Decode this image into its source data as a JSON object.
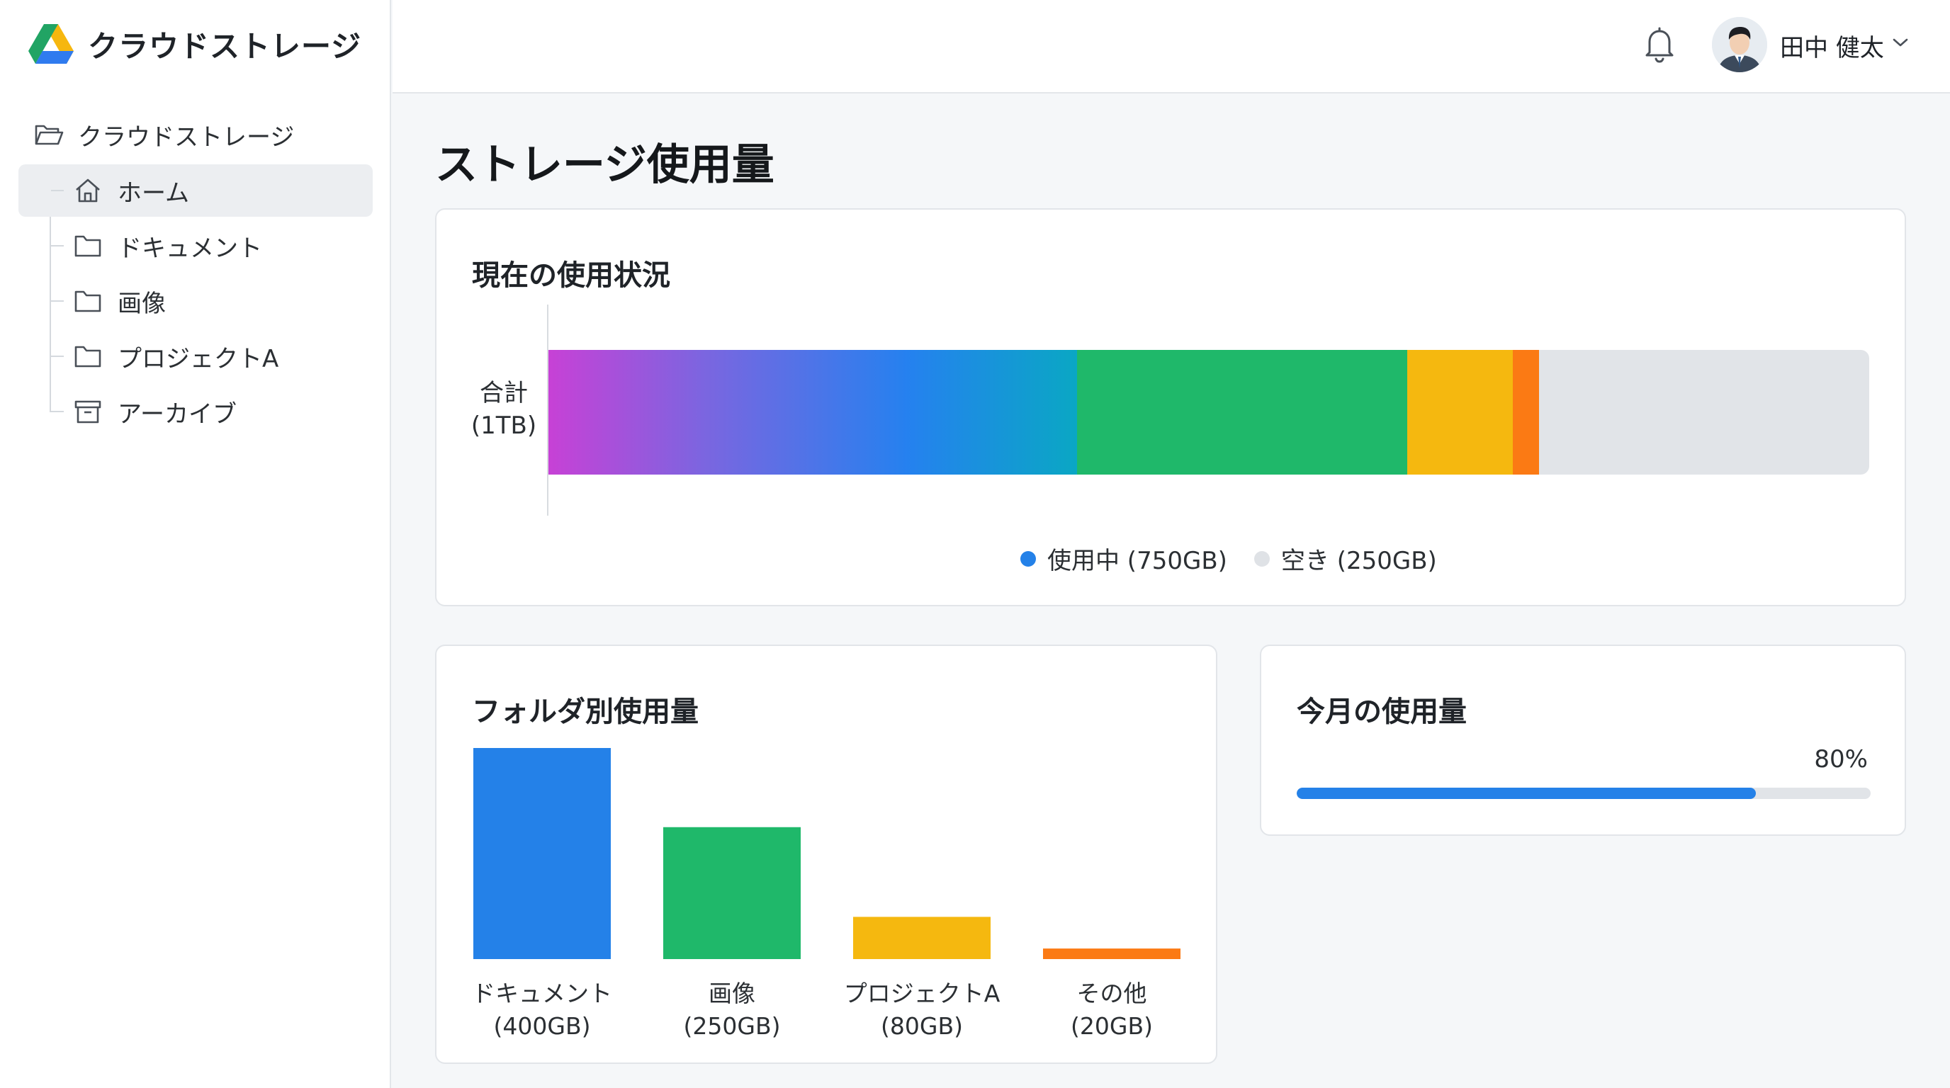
{
  "app": {
    "title": "クラウドストレージ",
    "logo_icon": "drive-logo-icon"
  },
  "sidebar": {
    "root_label": "クラウドストレージ",
    "items": [
      {
        "label": "ホーム",
        "icon": "home-icon",
        "active": true
      },
      {
        "label": "ドキュメント",
        "icon": "folder-icon",
        "active": false
      },
      {
        "label": "画像",
        "icon": "folder-icon",
        "active": false
      },
      {
        "label": "プロジェクトA",
        "icon": "folder-icon",
        "active": false
      },
      {
        "label": "アーカイブ",
        "icon": "archive-icon",
        "active": false
      }
    ]
  },
  "header": {
    "notification_icon": "bell-icon",
    "user_name": "田中 健太",
    "user_menu_icon": "chevron-down-icon"
  },
  "page": {
    "title": "ストレージ使用量"
  },
  "usage": {
    "title": "現在の使用状況",
    "total_label": "合計",
    "total_value": "(1TB)",
    "capacity_gb": 1000,
    "segments": [
      {
        "name": "ドキュメント",
        "gb": 400,
        "color": "gradient"
      },
      {
        "name": "画像",
        "gb": 250,
        "color": "#1fb86a"
      },
      {
        "name": "プロジェクトA",
        "gb": 80,
        "color": "#f5b80f"
      },
      {
        "name": "その他",
        "gb": 20,
        "color": "#fb7a14"
      }
    ],
    "legend": [
      {
        "label": "使用中 (750GB)",
        "color": "#2481e8"
      },
      {
        "label": "空き (250GB)",
        "color": "#dfe2e6"
      }
    ]
  },
  "folders": {
    "title": "フォルダ別使用量"
  },
  "chart_data": {
    "type": "bar",
    "categories": [
      "ドキュメント",
      "画像",
      "プロジェクトA",
      "その他"
    ],
    "value_labels": [
      "(400GB)",
      "(250GB)",
      "(80GB)",
      "(20GB)"
    ],
    "values": [
      400,
      250,
      80,
      20
    ],
    "colors": [
      "#2481e8",
      "#1fb86a",
      "#f5b80f",
      "#fb7a14"
    ],
    "title": "フォルダ別使用量",
    "xlabel": "",
    "ylabel": "",
    "ylim": [
      0,
      400
    ],
    "grid": false
  },
  "monthly": {
    "title": "今月の使用量",
    "percent_label": "80%",
    "percent": 80,
    "color": "#2481e8"
  }
}
